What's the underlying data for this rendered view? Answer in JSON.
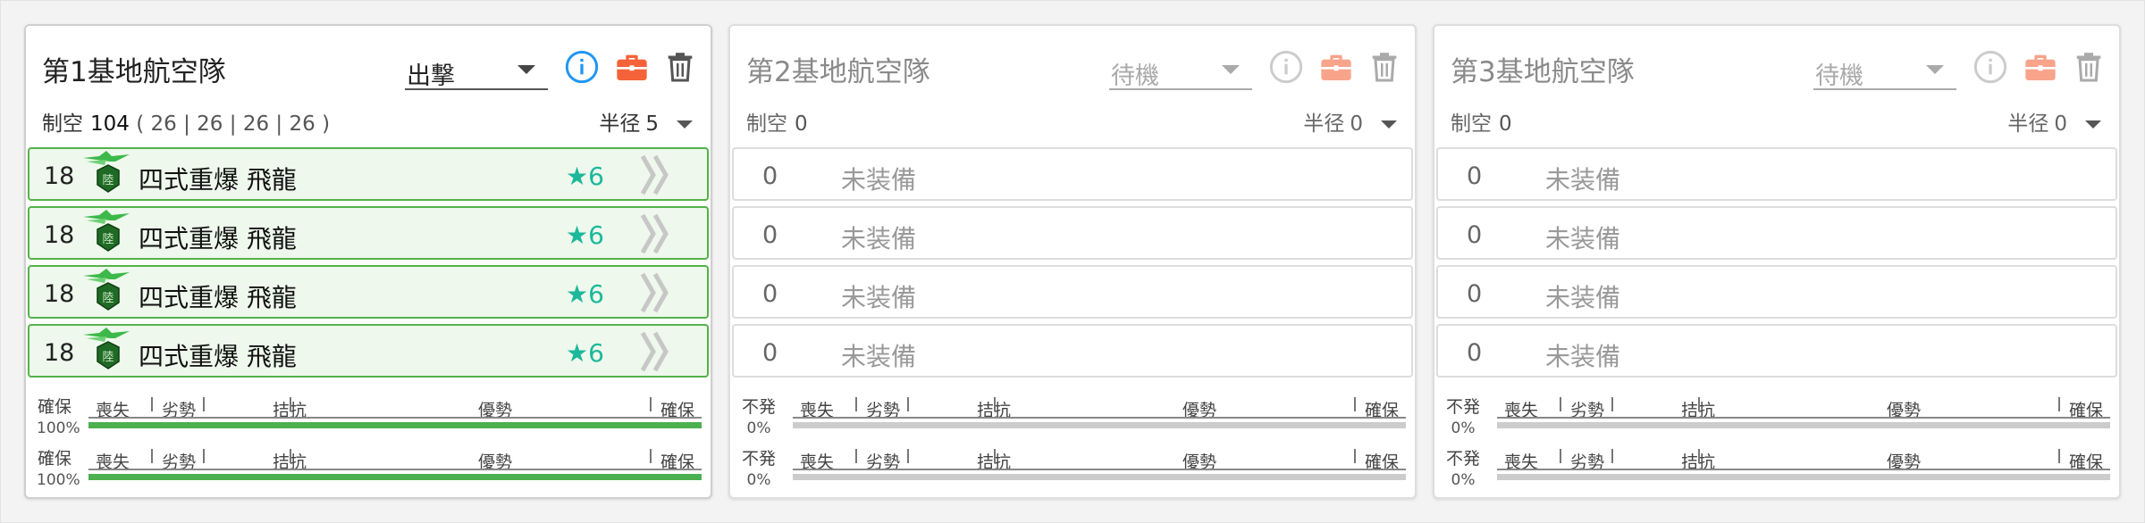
{
  "panels": [
    {
      "title": "第1基地航空隊",
      "mode": "出撃",
      "air_power_label": "制空",
      "air_power": "104",
      "air_power_breakdown": [
        "26",
        "26",
        "26",
        "26"
      ],
      "radius_label": "半径",
      "radius": "5",
      "active": true,
      "slots": [
        {
          "count": "18",
          "name": "四式重爆 飛龍",
          "star": "★6"
        },
        {
          "count": "18",
          "name": "四式重爆 飛龍",
          "star": "★6"
        },
        {
          "count": "18",
          "name": "四式重爆 飛龍",
          "star": "★6"
        },
        {
          "count": "18",
          "name": "四式重爆 飛龍",
          "star": "★6"
        }
      ],
      "bars": [
        {
          "status": "確保",
          "percent": "100%",
          "fill": 1.0
        },
        {
          "status": "確保",
          "percent": "100%",
          "fill": 1.0
        }
      ]
    },
    {
      "title": "第2基地航空隊",
      "mode": "待機",
      "air_power_label": "制空",
      "air_power": "0",
      "radius_label": "半径",
      "radius": "0",
      "active": false,
      "slots": [
        {
          "count": "0",
          "name": "未装備"
        },
        {
          "count": "0",
          "name": "未装備"
        },
        {
          "count": "0",
          "name": "未装備"
        },
        {
          "count": "0",
          "name": "未装備"
        }
      ],
      "bars": [
        {
          "status": "不発",
          "percent": "0%",
          "fill": 0
        },
        {
          "status": "不発",
          "percent": "0%",
          "fill": 0
        }
      ]
    },
    {
      "title": "第3基地航空隊",
      "mode": "待機",
      "air_power_label": "制空",
      "air_power": "0",
      "radius_label": "半径",
      "radius": "0",
      "active": false,
      "slots": [
        {
          "count": "0",
          "name": "未装備"
        },
        {
          "count": "0",
          "name": "未装備"
        },
        {
          "count": "0",
          "name": "未装備"
        },
        {
          "count": "0",
          "name": "未装備"
        }
      ],
      "bars": [
        {
          "status": "不発",
          "percent": "0%",
          "fill": 0
        },
        {
          "status": "不発",
          "percent": "0%",
          "fill": 0
        }
      ]
    }
  ],
  "bar_labels": [
    "喪失",
    "劣勢",
    "拮抗",
    "優勢",
    "確保"
  ],
  "colors": {
    "accent_blue": "#2196f3",
    "briefcase_orange": "#f4623a",
    "slot_green_border": "#55b24a",
    "slot_green_bg": "#eef8ec",
    "star_teal": "#1cb89b",
    "bar_green": "#4caf50"
  },
  "icons": [
    "info-icon",
    "briefcase-icon",
    "trash-icon",
    "chevron-down-icon",
    "heavy-bomber-icon",
    "proficiency-chevron-icon"
  ]
}
